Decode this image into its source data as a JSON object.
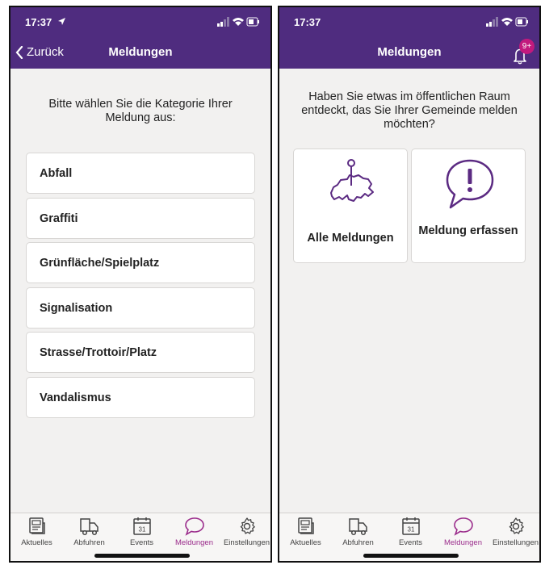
{
  "left_screen": {
    "status": {
      "time": "17:37"
    },
    "nav": {
      "back_label": "Zurück",
      "title": "Meldungen"
    },
    "prompt": "Bitte wählen Sie die Kategorie Ihrer Meldung aus:",
    "categories": [
      "Abfall",
      "Graffiti",
      "Grünfläche/Spielplatz",
      "Signalisation",
      "Strasse/Trottoir/Platz",
      "Vandalismus"
    ]
  },
  "right_screen": {
    "status": {
      "time": "17:37"
    },
    "nav": {
      "title": "Meldungen",
      "notification_badge": "9+"
    },
    "prompt": "Haben Sie etwas im öffentlichen Raum entdeckt, das Sie Ihrer Gemeinde melden möchten?",
    "tiles": [
      {
        "label": "Alle Meldungen",
        "icon": "switzerland-map-pin-icon"
      },
      {
        "label": "Meldung erfassen",
        "icon": "speech-bubble-exclamation-icon"
      }
    ]
  },
  "tabs": [
    {
      "label": "Aktuelles",
      "icon": "news-icon"
    },
    {
      "label": "Abfuhren",
      "icon": "truck-icon"
    },
    {
      "label": "Events",
      "icon": "calendar-icon",
      "day": "31"
    },
    {
      "label": "Meldungen",
      "icon": "speech-bubble-icon"
    },
    {
      "label": "Einstellungen",
      "icon": "gear-icon"
    }
  ],
  "active_tab": "Meldungen",
  "colors": {
    "header": "#4f2c7f",
    "accent": "#9b2d8c",
    "badge": "#c2197d",
    "background": "#f2f1f0"
  }
}
